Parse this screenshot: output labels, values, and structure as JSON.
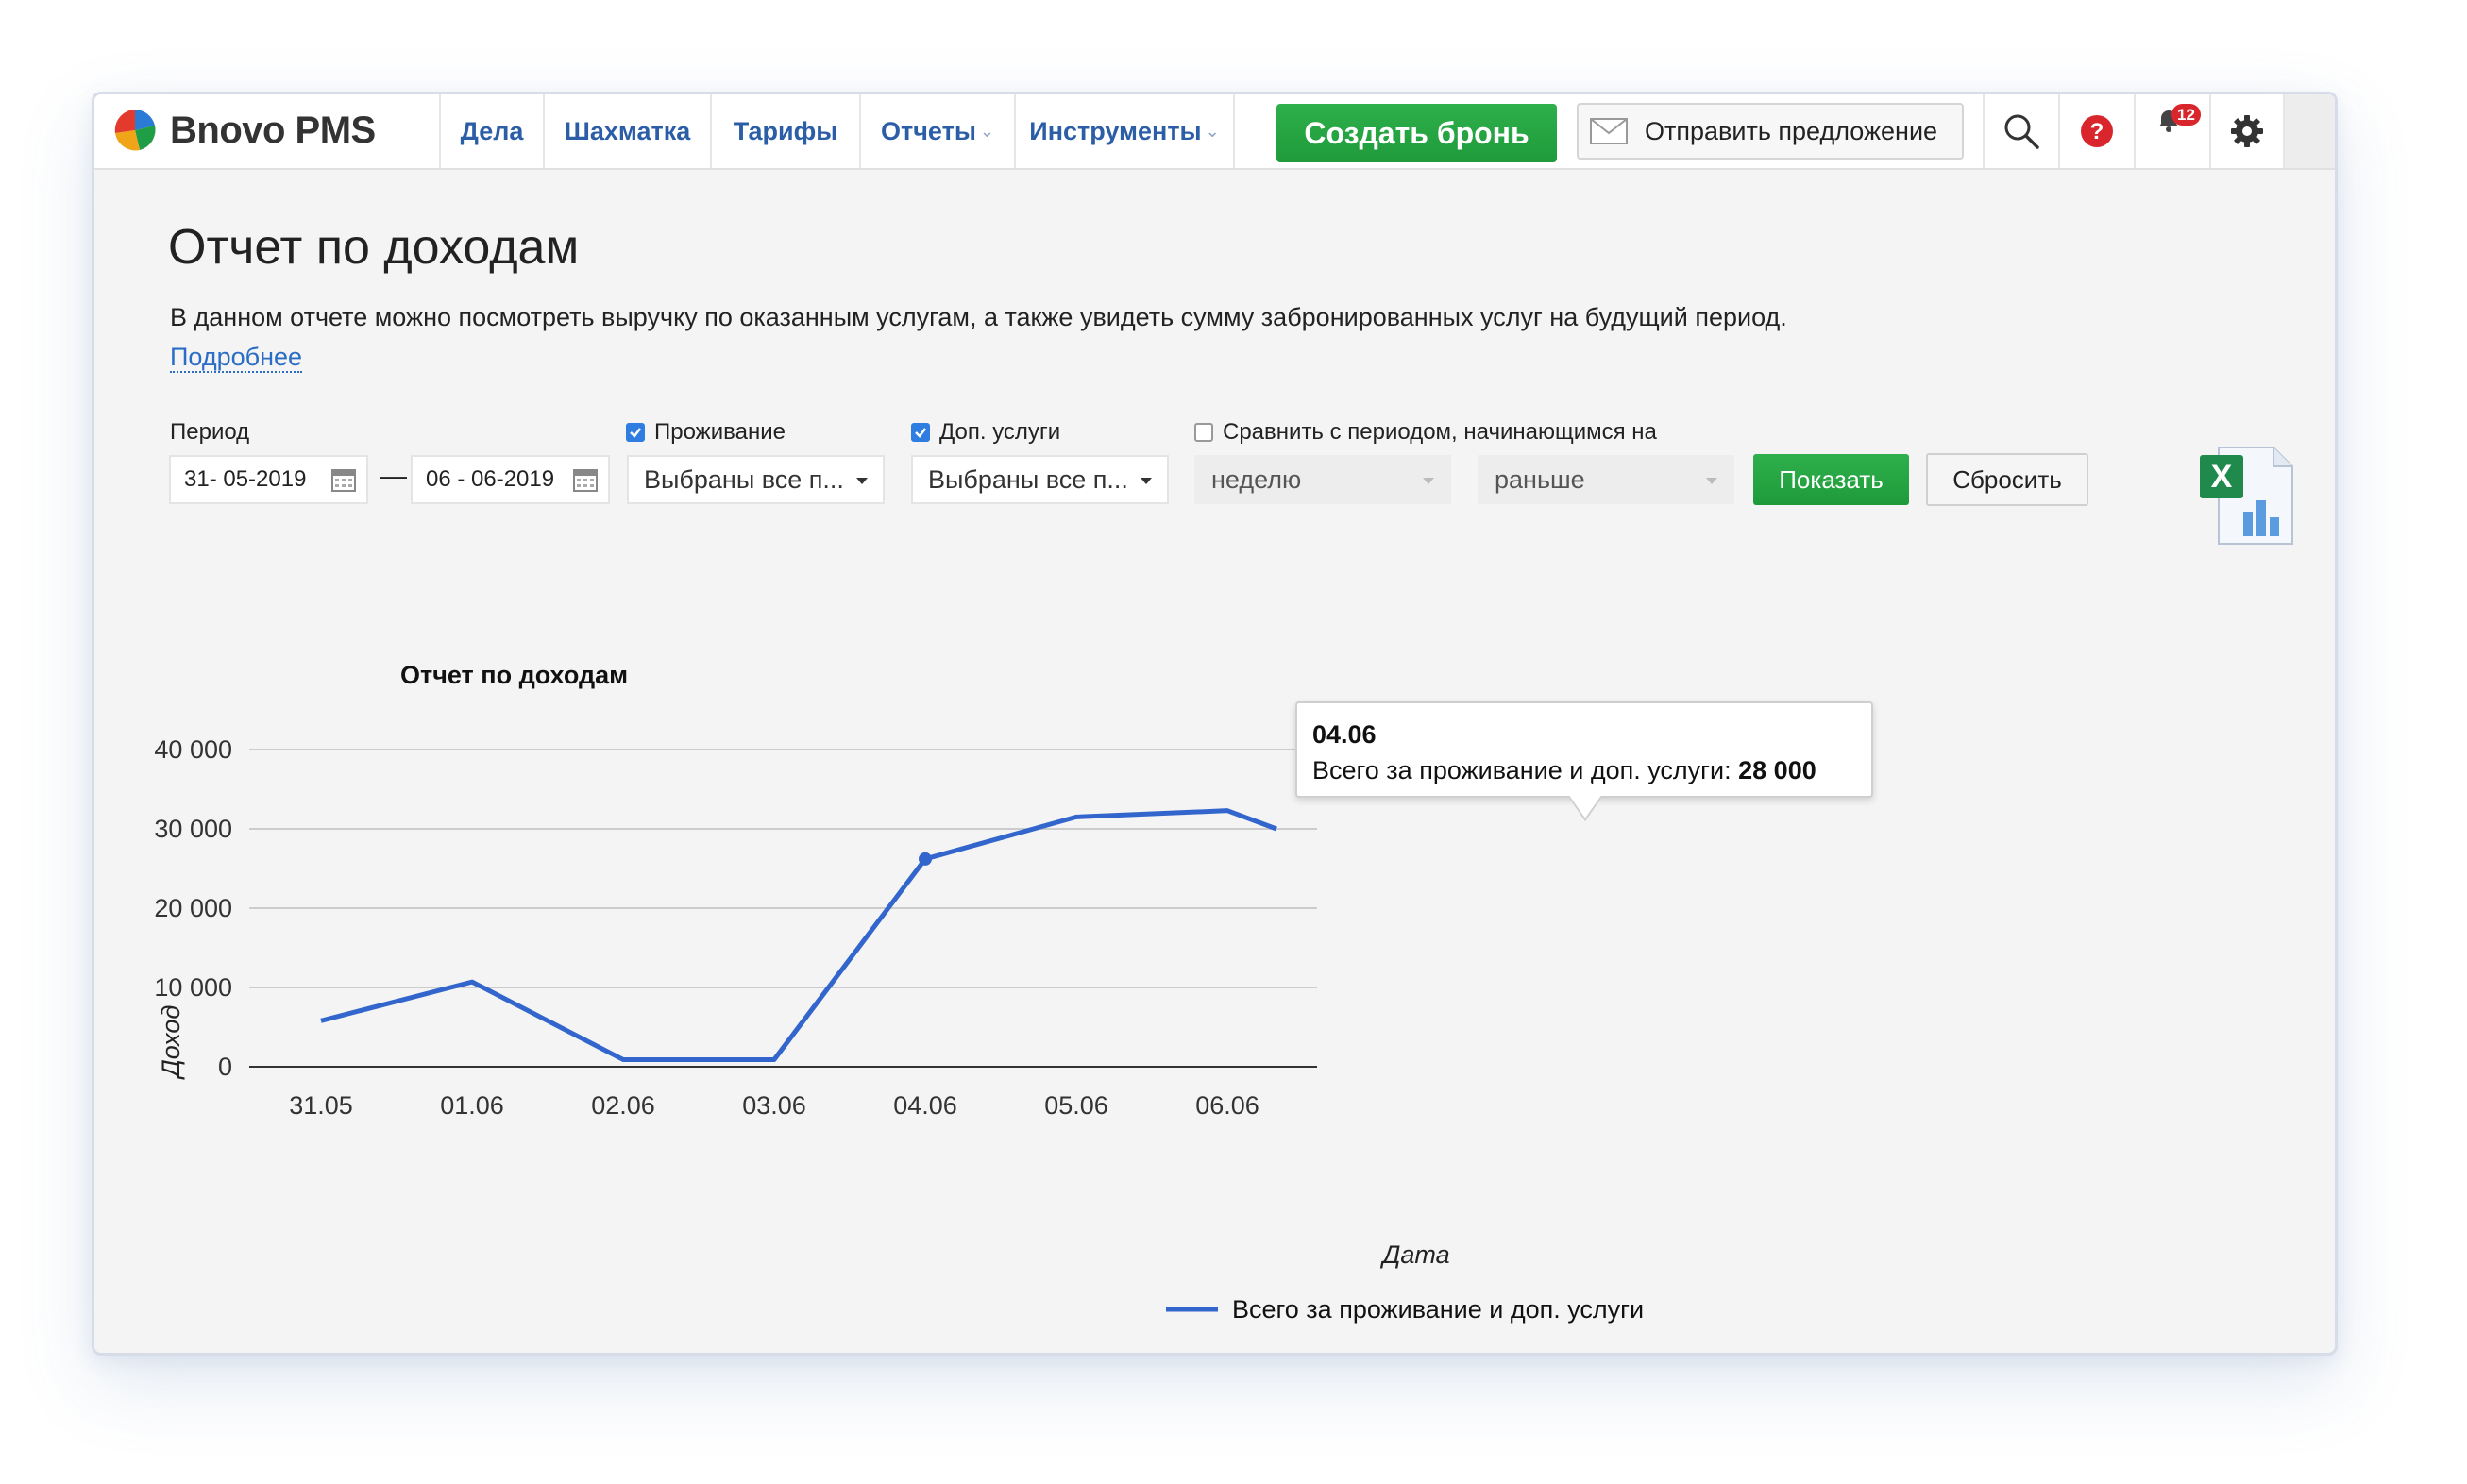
{
  "app": {
    "name": "Bnovo PMS"
  },
  "nav": {
    "items": [
      {
        "label": "Дела"
      },
      {
        "label": "Шахматка"
      },
      {
        "label": "Тарифы"
      },
      {
        "label": "Отчеты"
      },
      {
        "label": "Инструменты"
      }
    ],
    "create_label": "Создать бронь",
    "offer_label": "Отправить предложение",
    "notifications_count": "12"
  },
  "page": {
    "title": "Отчет по доходам",
    "description": "В данном отчете можно посмотреть выручку по оказанным услугам, а также увидеть сумму забронированных услуг на будущий период.",
    "more_link": "Подробнее"
  },
  "filters": {
    "period_label": "Период",
    "date_from": "31- 05-2019",
    "date_to": "06 - 06-2019",
    "dash": "—",
    "accommodation": {
      "label": "Проживание",
      "checked": true,
      "value": "Выбраны все п..."
    },
    "extra_services": {
      "label": "Доп. услуги",
      "checked": true,
      "value": "Выбраны все п..."
    },
    "compare": {
      "label": "Сравнить с периодом, начинающимся на",
      "checked": false,
      "unit": "неделю",
      "direction": "раньше"
    },
    "show_label": "Показать",
    "reset_label": "Сбросить"
  },
  "chart_data": {
    "type": "line",
    "title": "Отчет по доходам",
    "xlabel": "Дата",
    "ylabel": "Доход",
    "categories": [
      "31.05",
      "01.06",
      "02.06",
      "03.06",
      "04.06",
      "05.06",
      "06.06",
      ""
    ],
    "y_ticks": [
      "0",
      "10 000",
      "20 000",
      "30 000",
      "40 000"
    ],
    "ylim": [
      0,
      40000
    ],
    "grid": true,
    "legend": "bottom",
    "series": [
      {
        "name": "Всего за проживание и доп. услуги",
        "color": "#3366cc",
        "values": [
          5800,
          10700,
          900,
          900,
          26200,
          31500,
          32300,
          30000
        ]
      }
    ],
    "tooltip": {
      "title": "04.06",
      "label": "Всего за проживание и доп. услуги:",
      "value": "28 000"
    }
  }
}
